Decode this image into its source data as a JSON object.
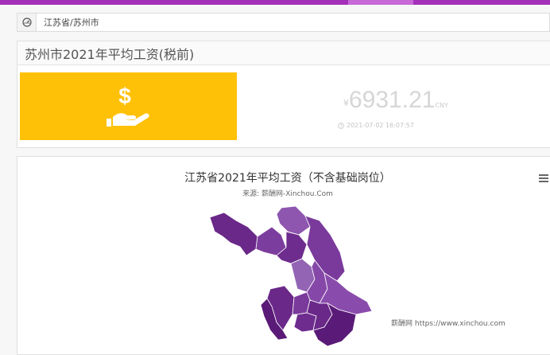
{
  "breadcrumb": {
    "icon": "dashboard-icon",
    "path": "江苏省/苏州市"
  },
  "summary": {
    "title": "苏州市2021年平均工资(税前)",
    "currency_symbol": "¥",
    "amount": "6931.21",
    "unit": "CNY",
    "date": "2021-07-02 16:07:57",
    "icon": "hand-dollar-icon"
  },
  "chart": {
    "title": "江苏省2021年平均工资（不含基础岗位）",
    "subtitle": "来源: 薪酬网-Xinchou.Com",
    "credit": "薪酬网 https://www.xinchou.com",
    "menu_icon": "hamburger-menu-icon"
  },
  "colors": {
    "accent": "#a42fb8",
    "money_box": "#ffc107",
    "map_dark": "#5c1a7a",
    "map_mid": "#7a3a9a",
    "map_light": "#9a66b8"
  }
}
